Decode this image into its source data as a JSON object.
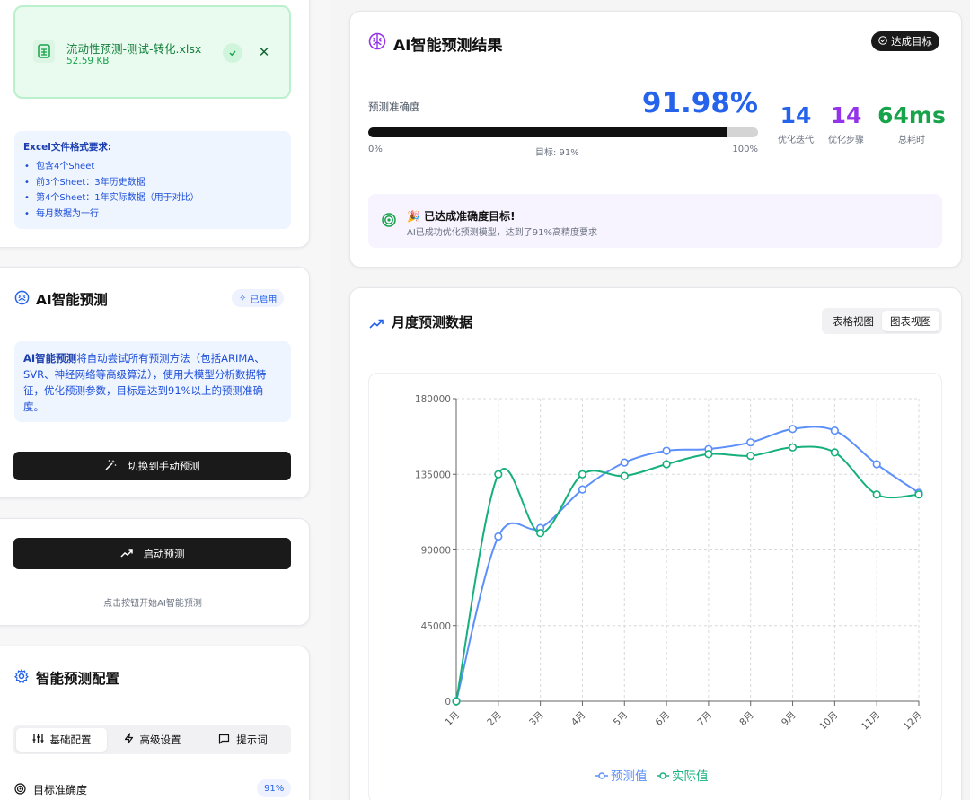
{
  "upload": {
    "file_name": "流动性预测-测试-转化.xlsx",
    "file_size": "52.59 KB",
    "close": "✕"
  },
  "requirements": {
    "title": "Excel文件格式要求:",
    "items": [
      "包含4个Sheet",
      "前3个Sheet：3年历史数据",
      "第4个Sheet：1年实际数据（用于对比）",
      "每月数据为一行"
    ]
  },
  "ai_panel": {
    "title": "AI智能预测",
    "badge": "已启用",
    "desc_strong": "AI智能预测",
    "desc_rest": "将自动尝试所有预测方法（包括ARIMA、SVR、神经网络等高级算法），使用大模型分析数据特征，优化预测参数，目标是达到91%以上的预测准确度。",
    "switch_button": "切换到手动预测"
  },
  "start_panel": {
    "start_button": "启动预测",
    "hint": "点击按钮开始AI智能预测"
  },
  "config": {
    "title": "智能预测配置",
    "tabs": [
      "基础配置",
      "高级设置",
      "提示词"
    ],
    "target_label": "目标准确度",
    "target_value": "91%"
  },
  "result": {
    "title": "AI智能预测结果",
    "goal_badge": "达成目标",
    "accuracy_label": "预测准确度",
    "accuracy_value": "91.98%",
    "accuracy_fraction": 0.9198,
    "scale_min": "0%",
    "scale_target": "目标: 91%",
    "scale_max": "100%",
    "stats": [
      {
        "value": "14",
        "label": "优化迭代",
        "color": "#2563eb"
      },
      {
        "value": "14",
        "label": "优化步骤",
        "color": "#9333ea"
      },
      {
        "value": "64ms",
        "label": "总耗时",
        "color": "#16a34a"
      }
    ],
    "success_emoji": "🎉",
    "success_title": "已达成准确度目标!",
    "success_desc": "AI已成功优化预测模型，达到了91%高精度要求"
  },
  "monthly": {
    "title": "月度预测数据",
    "views": [
      "表格视图",
      "图表视图"
    ],
    "active_view": "图表视图"
  },
  "chart_data": {
    "type": "line",
    "categories": [
      "1月",
      "2月",
      "3月",
      "4月",
      "5月",
      "6月",
      "7月",
      "8月",
      "9月",
      "10月",
      "11月",
      "12月"
    ],
    "series": [
      {
        "name": "预测值",
        "color": "#5b8ff9",
        "values": [
          0,
          98000,
          103000,
          126000,
          142000,
          149000,
          150000,
          154000,
          162000,
          161000,
          141000,
          124000
        ]
      },
      {
        "name": "实际值",
        "color": "#16b07c",
        "values": [
          0,
          135000,
          100000,
          135000,
          134000,
          141000,
          147000,
          146000,
          151000,
          148000,
          123000,
          123000
        ]
      }
    ],
    "ylim": [
      0,
      180000
    ],
    "yticks": [
      "180000",
      "135000",
      "90000",
      "45000",
      "0"
    ],
    "grid": true,
    "legend": "bottom"
  }
}
